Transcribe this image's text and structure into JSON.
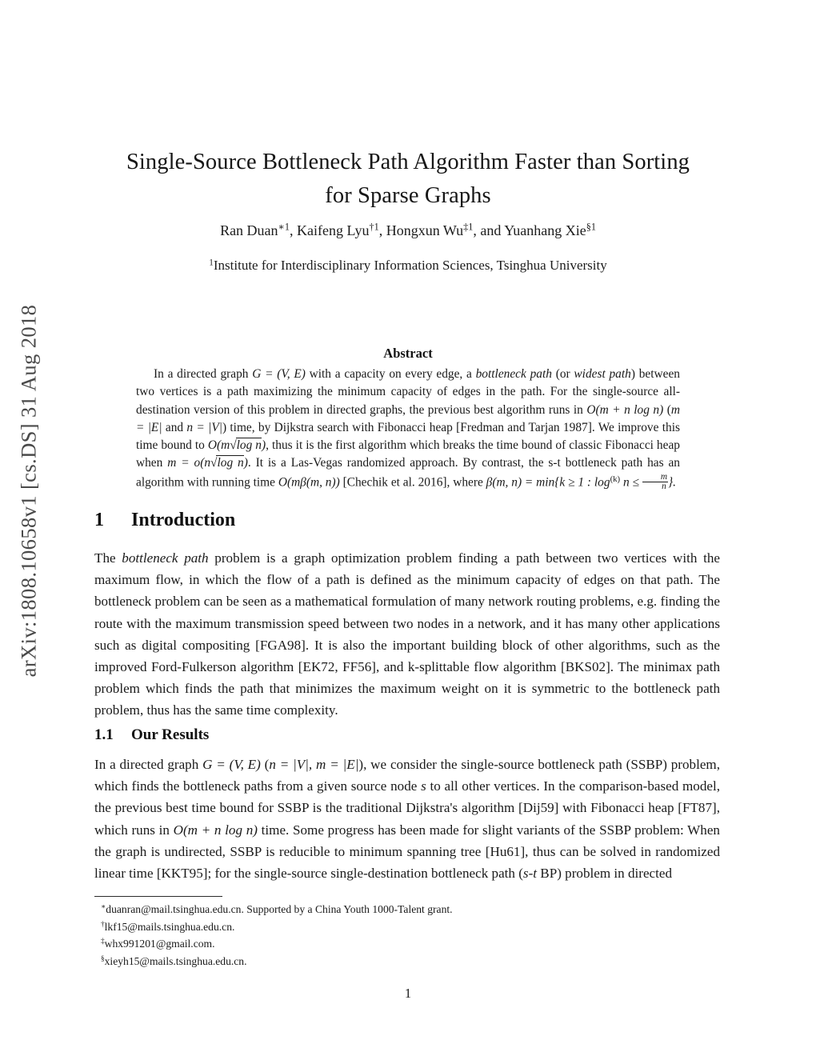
{
  "arxiv_stamp": "arXiv:1808.10658v1  [cs.DS]  31 Aug 2018",
  "title": {
    "line1": "Single-Source Bottleneck Path Algorithm Faster than Sorting",
    "line2": "for Sparse Graphs"
  },
  "authors": {
    "a1_name": "Ran Duan",
    "a1_marks": "∗1",
    "sep1": ", ",
    "a2_name": "Kaifeng Lyu",
    "a2_marks": "†1",
    "sep2": ", ",
    "a3_name": "Hongxun Wu",
    "a3_marks": "‡1",
    "sep3": ", and ",
    "a4_name": "Yuanhang Xie",
    "a4_marks": "§1"
  },
  "affiliation": {
    "mark": "1",
    "text": "Institute for Interdisciplinary Information Sciences, Tsinghua University"
  },
  "abstract": {
    "heading": "Abstract",
    "s1": "In a directed graph ",
    "m_G": "G = (V, E)",
    "s2": " with a capacity on every edge, a ",
    "em1": "bottleneck path",
    "s3": " (or ",
    "em2": "widest path",
    "s4": ") between two vertices is a path maximizing the minimum capacity of edges in the path. For the single-source all-destination version of this problem in directed graphs, the previous best algorithm runs in ",
    "m_O1": "O(m + n log n)",
    "s5": " (",
    "m_m": "m = |E|",
    "s6": " and ",
    "m_n": "n = |V|",
    "s7": ") time, by Dijkstra search with Fibonacci heap [Fredman and Tarjan 1987]. We improve this time bound to ",
    "m_O2_pre": "O(m",
    "m_O2_sqrt": "log n",
    "m_O2_post": ")",
    "s8": ", thus it is the first algorithm which breaks the time bound of classic Fibonacci heap when ",
    "m_o_pre": "m = o(n",
    "m_o_sqrt": "log n",
    "m_o_post": ")",
    "s9": ". It is a Las-Vegas randomized approach. By contrast, the s-t bottleneck path has an algorithm with running time ",
    "m_beta": "O(mβ(m, n))",
    "s10": " [Chechik et al. 2016], where ",
    "m_def_pre": "β(m, n) = min{k ≥ 1 : log",
    "m_def_k": "(k)",
    "m_def_mid": " n ≤ ",
    "m_frac_num": "m",
    "m_frac_den": "n",
    "m_def_post": "}."
  },
  "sections": {
    "intro": {
      "number": "1",
      "label": "Introduction"
    },
    "results": {
      "number": "1.1",
      "label": "Our Results"
    }
  },
  "intro_paragraph": {
    "p1": "The ",
    "em1": "bottleneck path",
    "p2": " problem is a graph optimization problem finding a path between two vertices with the maximum flow, in which the flow of a path is defined as the minimum capacity of edges on that path. The bottleneck problem can be seen as a mathematical formulation of many network routing problems, e.g. finding the route with the maximum transmission speed between two nodes in a network, and it has many other applications such as digital compositing [FGA98]. It is also the important building block of other algorithms, such as the improved Ford-Fulkerson algorithm [EK72, FF56], and k-splittable flow algorithm [BKS02]. The minimax path problem which finds the path that minimizes the maximum weight on it is symmetric to the bottleneck path problem, thus has the same time complexity."
  },
  "results_paragraph": {
    "r1": "In a directed graph ",
    "m_G": "G = (V, E)",
    "r2": " (",
    "m_nm": "n = |V|, m = |E|",
    "r3": "), we consider the single-source bottleneck path (SSBP) problem, which finds the bottleneck paths from a given source node ",
    "m_s": "s",
    "r4": " to all other vertices. In the comparison-based model, the previous best time bound for SSBP is the traditional Dijkstra's algorithm [Dij59] with Fibonacci heap [FT87], which runs in ",
    "m_O": "O(m + n log n)",
    "r5": " time. Some progress has been made for slight variants of the SSBP problem: When the graph is undirected, SSBP is reducible to minimum spanning tree [Hu61], thus can be solved in randomized linear time [KKT95]; for the single-source single-destination bottleneck path (",
    "m_st": "s-t",
    "r6": " BP) problem in directed"
  },
  "footnotes": [
    {
      "mark": "∗",
      "text": "duanran@mail.tsinghua.edu.cn. Supported by a China Youth 1000-Talent grant."
    },
    {
      "mark": "†",
      "text": "lkf15@mails.tsinghua.edu.cn."
    },
    {
      "mark": "‡",
      "text": "whx991201@gmail.com."
    },
    {
      "mark": "§",
      "text": "xieyh15@mails.tsinghua.edu.cn."
    }
  ],
  "page_number": "1"
}
